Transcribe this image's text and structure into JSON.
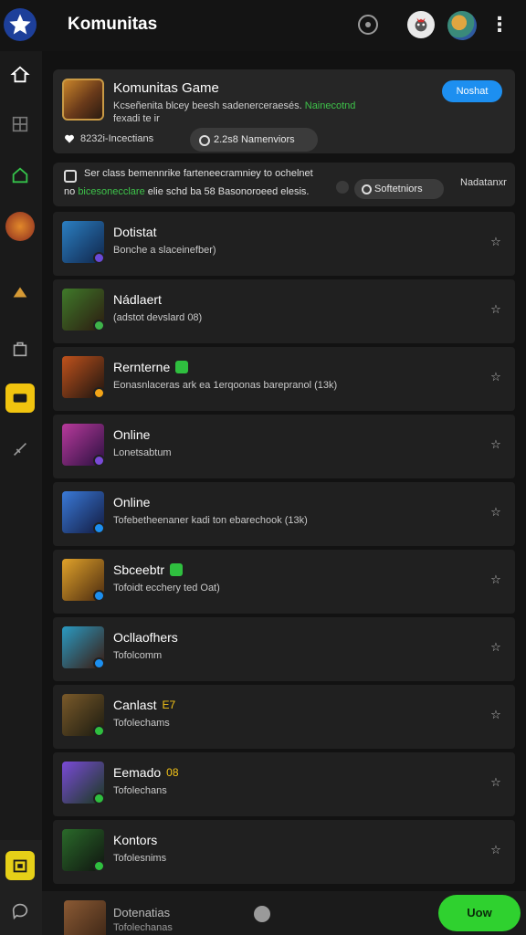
{
  "header": {
    "title": "Komunitas",
    "icons": [
      "star-logo-icon",
      "notification-icon",
      "mascot-icon",
      "user-avatar",
      "more-icon"
    ]
  },
  "sidebar": {
    "items": [
      {
        "name": "home-icon"
      },
      {
        "name": "grid-icon"
      },
      {
        "name": "house-icon"
      },
      {
        "name": "game-avatar-1"
      },
      {
        "name": "game-avatar-2"
      },
      {
        "name": "bag-icon"
      },
      {
        "name": "chat-icon"
      },
      {
        "name": "sword-icon"
      },
      {
        "name": "camera-icon"
      },
      {
        "name": "message-icon"
      }
    ]
  },
  "group": {
    "name": "Komunitas Game",
    "desc_prefix": "Kcseñenita blcey beesh sadenerceraesés.",
    "desc_accent": "Nainecotnd",
    "members": "fexadi te ir",
    "join_label": "Noshat",
    "stat_label": "8232i-Incectians",
    "pill_label": "2.2s8 Namenviors"
  },
  "info": {
    "line1": "Ser class bemennrike farteneecramniey to ochelnet",
    "line2_accent": "bicesonecclare",
    "line2_prefix": "no",
    "line2_suffix": "elie schd ba 58 Basonoroeed elesis.",
    "filter_label": "Softetniors",
    "sort_label": "Nadatanxr"
  },
  "games": [
    {
      "name": "Dotistat",
      "sub": "Bonche a slaceinefber)",
      "tag": "",
      "thumb_a": "#2b7fc2",
      "thumb_b": "#10254a",
      "badge": "#6a4ad8"
    },
    {
      "name": "Nádlaert",
      "sub": "(adstot devslard 08)",
      "tag": "",
      "thumb_a": "#3f7a2a",
      "thumb_b": "#2c1a10",
      "badge": "#3eb34a"
    },
    {
      "name": "Rernterne",
      "sub": "Eonasnlaceras ark ea 1erqoonas barepranol (13k)",
      "tag": "green",
      "thumb_a": "#c0521c",
      "thumb_b": "#1b1410",
      "badge": "#f3a417"
    },
    {
      "name": "Online",
      "sub": "Lonetsabtum",
      "tag": "",
      "thumb_a": "#b83a9c",
      "thumb_b": "#2a1040",
      "badge": "#7a4ad8"
    },
    {
      "name": "Online",
      "sub": "Tofebetheenaner kadi ton ebarechook (13k)",
      "tag": "",
      "thumb_a": "#3a7ad8",
      "thumb_b": "#121a40",
      "badge": "#1c8ff0"
    },
    {
      "name": "Sbceebtr",
      "sub": "Tofoidt ecchery ted Oat)",
      "tag": "green",
      "thumb_a": "#e0a22a",
      "thumb_b": "#4a2a10",
      "badge": "#1c8ff0"
    },
    {
      "name": "Ocllaofhers",
      "sub": "Tofolcomm",
      "tag": "",
      "thumb_a": "#2a9ac2",
      "thumb_b": "#3a1a10",
      "badge": "#1c8ff0"
    },
    {
      "name": "Canlast",
      "sub": "Tofolechams",
      "tag": "yellow",
      "tag_text": "E7",
      "thumb_a": "#7a5a2a",
      "thumb_b": "#1a1a10",
      "badge": "#2fbf3f"
    },
    {
      "name": "Eemado",
      "sub": "Tofolechans",
      "tag": "yellow",
      "tag_text": "08",
      "thumb_a": "#7a4ad8",
      "thumb_b": "#1a3a20",
      "badge": "#2fbf3f"
    },
    {
      "name": "Kontors",
      "sub": "Tofolesnims",
      "tag": "",
      "thumb_a": "#2a6a2a",
      "thumb_b": "#101410",
      "badge": "#2fbf3f"
    }
  ],
  "bottom": {
    "name": "Dotenatias",
    "sub": "Tofolechanas",
    "fab_label": "Uow"
  }
}
